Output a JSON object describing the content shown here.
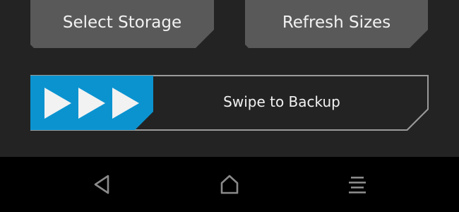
{
  "buttons": {
    "select_storage": "Select Storage",
    "refresh_sizes": "Refresh Sizes"
  },
  "swipe": {
    "label": "Swipe to Backup",
    "handle_icon": "triple-chevron-right-icon",
    "handle_color": "#0b93d0"
  },
  "navbar": {
    "back_icon": "back-triangle-icon",
    "home_icon": "home-icon",
    "menu_icon": "menu-icon"
  }
}
